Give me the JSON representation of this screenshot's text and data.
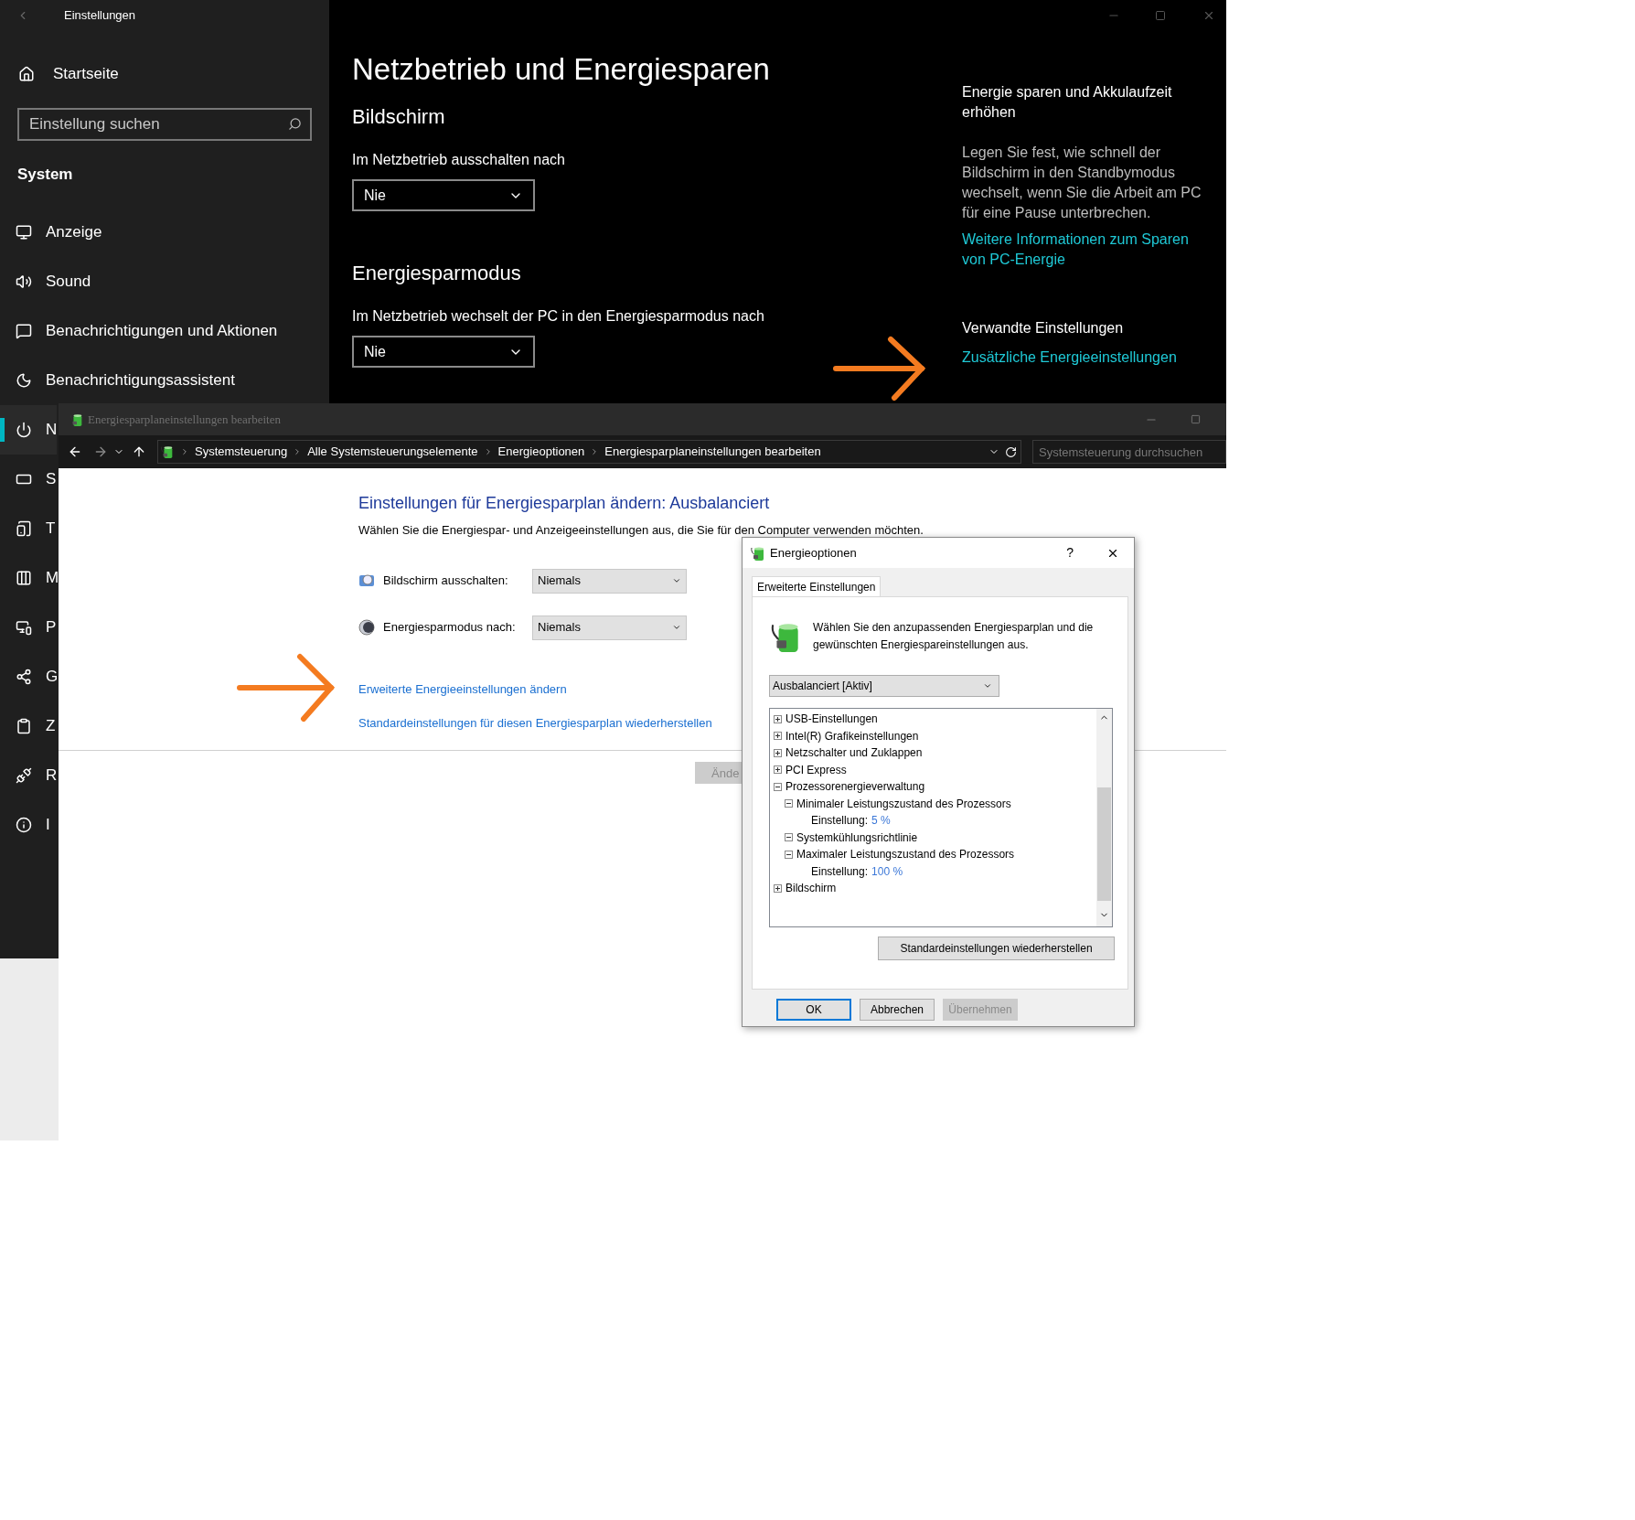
{
  "settings_window": {
    "title": "Einstellungen",
    "sidebar": {
      "home": "Startseite",
      "search": {
        "placeholder": "Einstellung suchen"
      },
      "section": "System",
      "items": [
        {
          "label": "Anzeige",
          "selected": false
        },
        {
          "label": "Sound",
          "selected": false
        },
        {
          "label": "Benachrichtigungen und Aktionen",
          "selected": false
        },
        {
          "label": "Benachrichtigungsassistent",
          "selected": false
        },
        {
          "label": "N",
          "selected": true
        },
        {
          "label": "S",
          "selected": false
        },
        {
          "label": "T",
          "selected": false
        },
        {
          "label": "M",
          "selected": false
        },
        {
          "label": "P",
          "selected": false
        },
        {
          "label": "G",
          "selected": false
        },
        {
          "label": "Z",
          "selected": false
        },
        {
          "label": "R",
          "selected": false
        },
        {
          "label": "I",
          "selected": false
        }
      ]
    },
    "page": {
      "title": "Netzbetrieb und Energiesparen",
      "sections": [
        {
          "heading": "Bildschirm",
          "label": "Im Netzbetrieb ausschalten nach",
          "value": "Nie"
        },
        {
          "heading": "Energiesparmodus",
          "label": "Im Netzbetrieb wechselt der PC in den Energiesparmodus nach",
          "value": "Nie"
        }
      ],
      "aside": {
        "heading": "Energie sparen und Akkulaufzeit erhöhen",
        "text": "Legen Sie fest, wie schnell der Bildschirm in den Standbymodus wechselt, wenn Sie die Arbeit am PC für eine Pause unterbrechen.",
        "link": "Weitere Informationen zum Sparen von PC-Energie",
        "related_heading": "Verwandte Einstellungen",
        "related_link": "Zusätzliche Energieeinstellungen"
      }
    }
  },
  "control_panel": {
    "title": "Energiesparplaneinstellungen bearbeiten",
    "breadcrumb": [
      "Systemsteuerung",
      "Alle Systemsteuerungselemente",
      "Energieoptionen",
      "Energiesparplaneinstellungen bearbeiten"
    ],
    "search": {
      "placeholder": "Systemsteuerung durchsuchen"
    },
    "heading": "Einstellungen für Energiesparplan ändern: Ausbalanciert",
    "description": "Wählen Sie die Energiespar- und Anzeigeeinstellungen aus, die Sie für den Computer verwenden möchten.",
    "settings": [
      {
        "label": "Bildschirm ausschalten:",
        "value": "Niemals"
      },
      {
        "label": "Energiesparmodus nach:",
        "value": "Niemals"
      }
    ],
    "links": [
      "Erweiterte Energieeinstellungen ändern",
      "Standardeinstellungen für diesen Energiesparplan wiederherstellen"
    ],
    "button": {
      "label": "Ände",
      "disabled": true
    }
  },
  "dialog": {
    "title": "Energieoptionen",
    "help": "?",
    "tab": "Erweiterte Einstellungen",
    "intro": "Wählen Sie den anzupassenden Energiesparplan und die gewünschten Energiespareinstellungen aus.",
    "plan": "Ausbalanciert [Aktiv]",
    "tree": [
      {
        "kind": "group",
        "label": "USB-Einstellungen",
        "expanded": false
      },
      {
        "kind": "group",
        "label": "Intel(R) Grafikeinstellungen",
        "expanded": false
      },
      {
        "kind": "group",
        "label": "Netzschalter und Zuklappen",
        "expanded": false
      },
      {
        "kind": "group",
        "label": "PCI Express",
        "expanded": false
      },
      {
        "kind": "group",
        "label": "Prozessorenergieverwaltung",
        "expanded": true,
        "children": [
          {
            "kind": "group",
            "label": "Minimaler Leistungszustand des Prozessors",
            "expanded": true,
            "children": [
              {
                "kind": "setting",
                "label": "Einstellung:",
                "value": "5 %"
              }
            ]
          },
          {
            "kind": "group",
            "label": "Systemkühlungsrichtlinie",
            "expanded": true
          },
          {
            "kind": "group",
            "label": "Maximaler Leistungszustand des Prozessors",
            "expanded": true,
            "children": [
              {
                "kind": "setting",
                "label": "Einstellung:",
                "value": "100 %"
              }
            ]
          }
        ]
      },
      {
        "kind": "group",
        "label": "Bildschirm",
        "expanded": false
      }
    ],
    "restore_button": "Standardeinstellungen wiederherstellen",
    "buttons": [
      {
        "label": "OK",
        "default": true,
        "disabled": false
      },
      {
        "label": "Abbrechen",
        "default": false,
        "disabled": false
      },
      {
        "label": "Übernehmen",
        "default": false,
        "disabled": true
      }
    ]
  }
}
